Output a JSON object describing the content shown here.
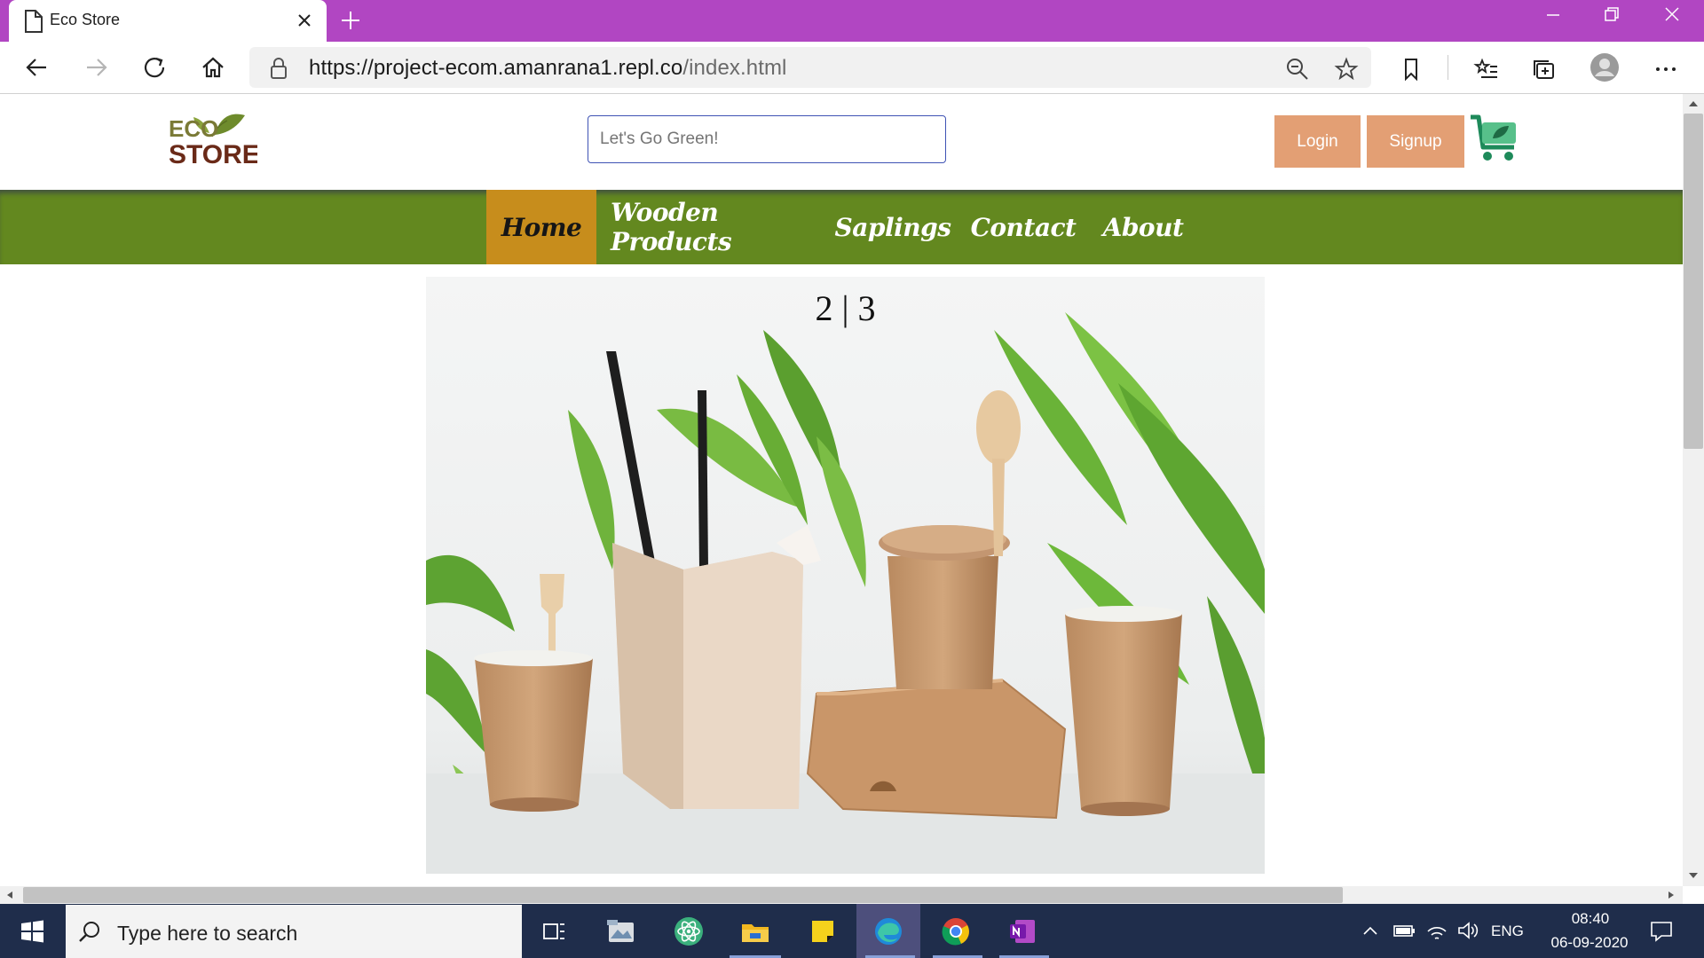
{
  "browser": {
    "tab_title": "Eco Store",
    "url_host": "https://project-ecom.amanrana1.repl.co",
    "url_path": "/index.html"
  },
  "site": {
    "logo_text_1": "ECO",
    "logo_text_2": "STORE",
    "search_placeholder": "Let's Go Green!",
    "login_label": "Login",
    "signup_label": "Signup",
    "nav": [
      "Home",
      "Wooden Products",
      "Saplings",
      "Contact",
      "About"
    ],
    "slide_counter": "2 | 3"
  },
  "taskbar": {
    "search_placeholder": "Type here to search",
    "lang": "ENG",
    "time": "08:40",
    "date": "06-09-2020"
  },
  "colors": {
    "titlebar": "#b146c2",
    "nav_bg": "#63881f",
    "nav_active": "#c78d1c",
    "auth_buttons": "#e39f74"
  }
}
